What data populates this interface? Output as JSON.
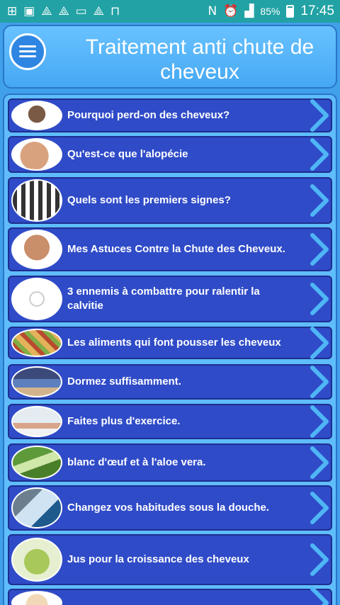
{
  "status_bar": {
    "battery": "85%",
    "time": "17:45"
  },
  "header": {
    "title": "Traitement anti chute de cheveux"
  },
  "items": [
    {
      "label": "Pourquoi perd-on des cheveux?",
      "icon": "hair-loss-head-icon"
    },
    {
      "label": "Qu'est-ce que l'alopécie",
      "icon": "bald-head-icon"
    },
    {
      "label": "Quels sont les premiers signes?",
      "icon": "hairline-stages-icon"
    },
    {
      "label": "Mes Astuces Contre la Chute des Cheveux.",
      "icon": "worried-man-icon"
    },
    {
      "label": "3 ennemis à combattre pour ralentir la calvitie",
      "icon": "stress-sketch-icon"
    },
    {
      "label": "Les aliments qui font pousser les cheveux",
      "icon": "foods-icon"
    },
    {
      "label": "Dormez suffisamment.",
      "icon": "sleeping-person-icon"
    },
    {
      "label": "Faites plus d'exercice.",
      "icon": "exercise-icon"
    },
    {
      "label": "blanc d'œuf et à l'aloe vera.",
      "icon": "aloe-vera-icon"
    },
    {
      "label": "Changez vos habitudes sous la douche.",
      "icon": "shower-icon"
    },
    {
      "label": "Jus pour la croissance des cheveux",
      "icon": "green-juice-icon"
    },
    {
      "label": "",
      "icon": "person-icon"
    }
  ],
  "colors": {
    "status_bar": "#22a2a4",
    "background": "#41a0ea",
    "row": "#2f4bc8",
    "chevron": "#4fb6f5"
  }
}
